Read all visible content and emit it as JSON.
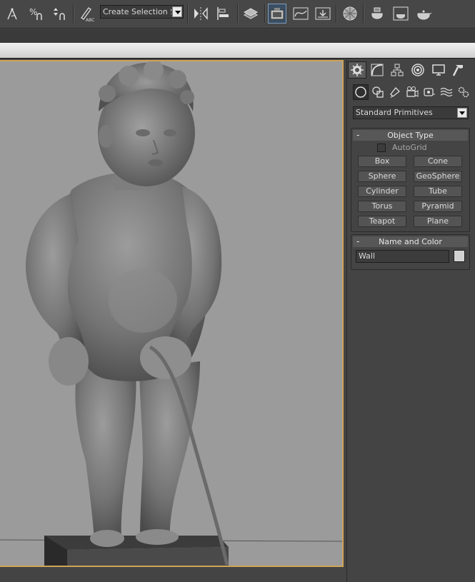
{
  "toolbar": {
    "selection_set_text": "Create Selection Se",
    "icons": [
      "angle-snap-icon",
      "percent-snap-icon",
      "spinner-snap-icon",
      "edit-named-selection-icon",
      "mirror-icon",
      "align-icon",
      "layer-manager-icon",
      "graphite-modeling-icon",
      "curve-editor-icon",
      "schematic-view-icon",
      "material-editor-icon",
      "render-setup-icon",
      "rendered-frame-window-icon",
      "render-production-icon"
    ]
  },
  "command_panel": {
    "tabs": [
      "create-tab",
      "modify-tab",
      "hierarchy-tab",
      "motion-tab",
      "display-tab",
      "utilities-tab"
    ],
    "subtabs": [
      "geometry-subtab",
      "shapes-subtab",
      "lights-subtab",
      "cameras-subtab",
      "helpers-subtab",
      "space-warps-subtab",
      "systems-subtab"
    ],
    "category": "Standard Primitives",
    "object_type": {
      "title": "Object Type",
      "autogrid_label": "AutoGrid",
      "autogrid_checked": false,
      "buttons": [
        "Box",
        "Cone",
        "Sphere",
        "GeoSphere",
        "Cylinder",
        "Tube",
        "Torus",
        "Pyramid",
        "Teapot",
        "Plane"
      ]
    },
    "name_and_color": {
      "title": "Name and Color",
      "name_value": "Wall",
      "color": "#d2d2d2"
    }
  },
  "viewport": {
    "background": "#9a9a9a",
    "border_color": "#cfa45a"
  }
}
